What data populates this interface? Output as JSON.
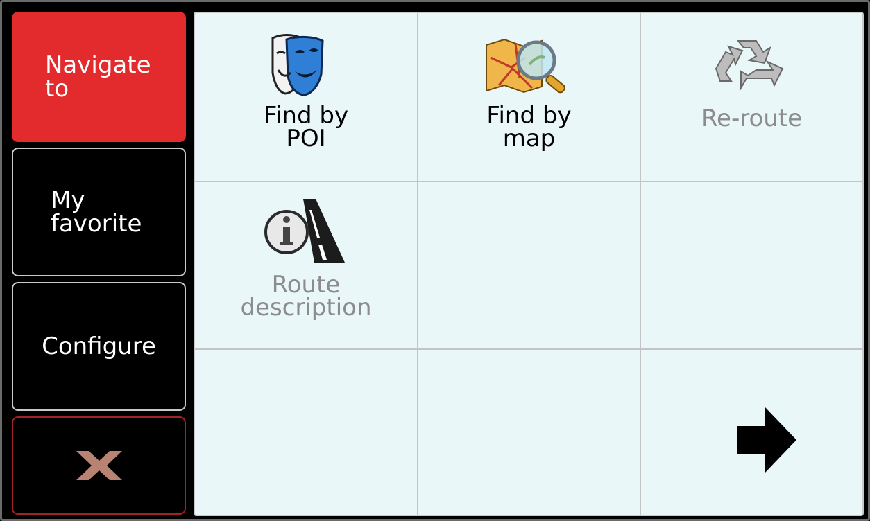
{
  "sidebar": {
    "items": [
      {
        "label": "Navigate\nto",
        "state": "active"
      },
      {
        "label": "My\nfavorite"
      },
      {
        "label": "Configure"
      },
      {
        "icon": "close-icon"
      }
    ]
  },
  "grid": {
    "cells": [
      {
        "label": "Find by\nPOI",
        "icon": "theater-mask-icon",
        "enabled": true
      },
      {
        "label": "Find by\nmap",
        "icon": "map-magnifier-icon",
        "enabled": true
      },
      {
        "label": "Re-route",
        "icon": "recycle-icon",
        "enabled": false
      },
      {
        "label": "Route\ndescription",
        "icon": "info-road-icon",
        "enabled": false
      }
    ],
    "next_icon": "right-arrow-icon"
  },
  "colors": {
    "active_red": "#e32b2e",
    "panel_bg": "#e9f7f8",
    "disabled_text": "#8c8c8c",
    "close_icon": "#b98374"
  }
}
